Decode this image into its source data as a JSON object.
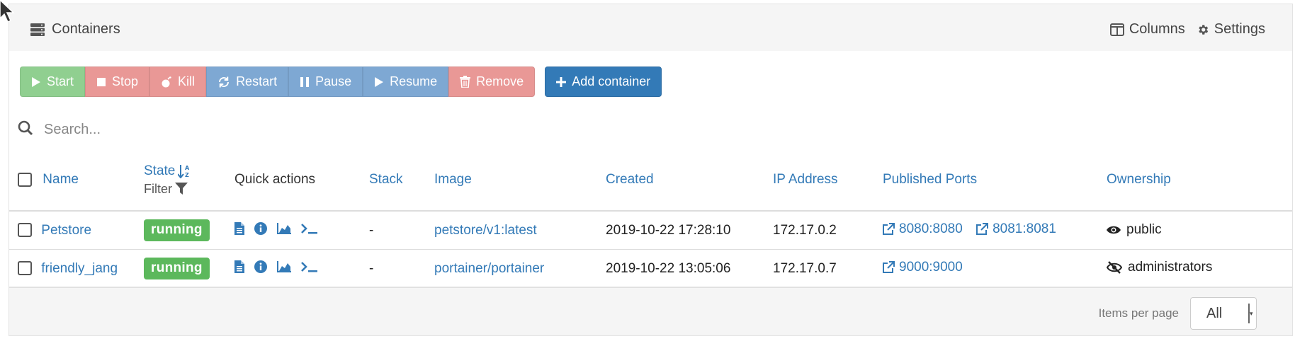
{
  "header": {
    "title": "Containers",
    "columns_label": "Columns",
    "settings_label": "Settings"
  },
  "toolbar": {
    "start": "Start",
    "stop": "Stop",
    "kill": "Kill",
    "restart": "Restart",
    "pause": "Pause",
    "resume": "Resume",
    "remove": "Remove",
    "add": "Add container"
  },
  "search": {
    "placeholder": "Search..."
  },
  "table": {
    "headers": {
      "name": "Name",
      "state": "State",
      "filter": "Filter",
      "quick_actions": "Quick actions",
      "stack": "Stack",
      "image": "Image",
      "created": "Created",
      "ip": "IP Address",
      "ports": "Published Ports",
      "ownership": "Ownership"
    },
    "rows": [
      {
        "name": "Petstore",
        "state": "running",
        "stack": "-",
        "image": "petstore/v1:latest",
        "created": "2019-10-22 17:28:10",
        "ip": "172.17.0.2",
        "ports": [
          "8080:8080",
          "8081:8081"
        ],
        "ownership": "public"
      },
      {
        "name": "friendly_jang",
        "state": "running",
        "stack": "-",
        "image": "portainer/portainer",
        "created": "2019-10-22 13:05:06",
        "ip": "172.17.0.7",
        "ports": [
          "9000:9000"
        ],
        "ownership": "administrators"
      }
    ]
  },
  "footer": {
    "items_per_page_label": "Items per page",
    "items_per_page_value": "All"
  },
  "colors": {
    "primary": "#337ab7",
    "success": "#5cb85c",
    "panel": "#f5f5f5"
  }
}
